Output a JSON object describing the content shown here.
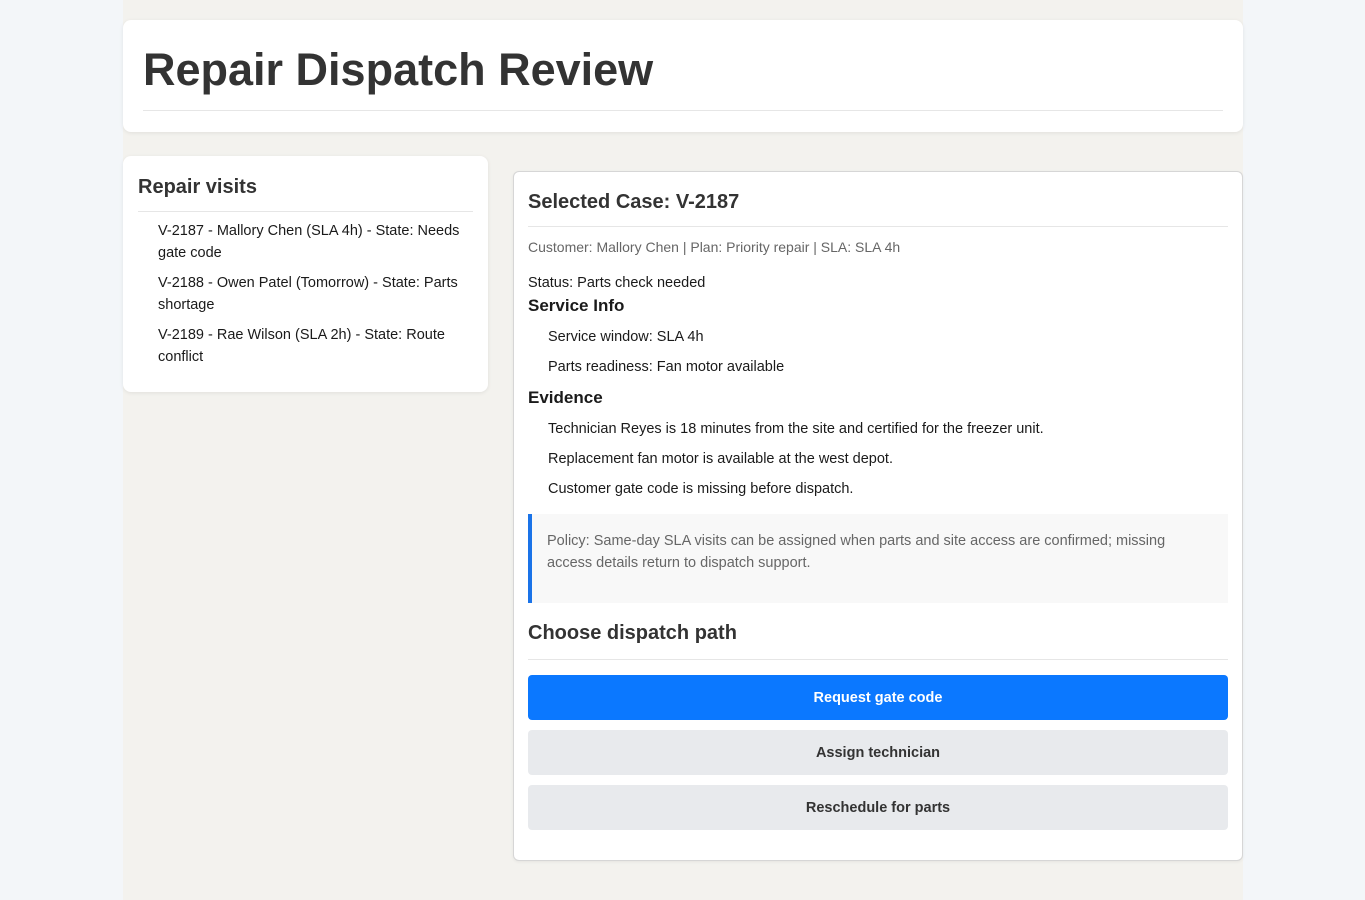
{
  "header": {
    "title": "Repair Dispatch Review"
  },
  "sidebar": {
    "title": "Repair visits",
    "visits": [
      {
        "label": "V-2187 - Mallory Chen (SLA 4h) - State: Needs gate code"
      },
      {
        "label": "V-2188 - Owen Patel (Tomorrow) - State: Parts shortage"
      },
      {
        "label": "V-2189 - Rae Wilson (SLA 2h) - State: Route conflict"
      }
    ]
  },
  "case": {
    "title": "Selected Case: V-2187",
    "meta": "Customer: Mallory Chen | Plan: Priority repair | SLA: SLA 4h",
    "status": "Status: Parts check needed",
    "service_info": {
      "heading": "Service Info",
      "items": [
        "Service window: SLA 4h",
        "Parts readiness: Fan motor available"
      ]
    },
    "evidence": {
      "heading": "Evidence",
      "items": [
        "Technician Reyes is 18 minutes from the site and certified for the freezer unit.",
        "Replacement fan motor is available at the west depot.",
        "Customer gate code is missing before dispatch."
      ]
    },
    "policy": "Policy: Same-day SLA visits can be assigned when parts and site access are confirmed; missing access details return to dispatch support."
  },
  "dispatch": {
    "heading": "Choose dispatch path",
    "buttons": {
      "request_gate_code": "Request gate code",
      "assign_technician": "Assign technician",
      "reschedule_for_parts": "Reschedule for parts"
    }
  },
  "colors": {
    "primary": "#0b78ff",
    "policy_accent": "#1a73e8",
    "secondary_button": "#e8eaed"
  }
}
